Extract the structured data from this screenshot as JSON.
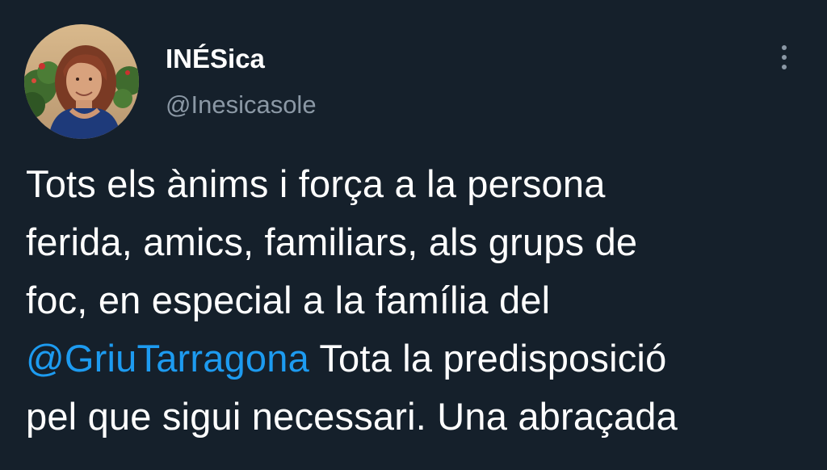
{
  "colors": {
    "background": "#15202b",
    "text_primary": "#ffffff",
    "text_secondary": "#8b98a5",
    "accent": "#1d9bf0"
  },
  "author": {
    "display_name": "INÉSica",
    "handle": "@Inesicasole",
    "avatar_icon": "profile-photo"
  },
  "actions": {
    "more_icon": "more-vertical-icon"
  },
  "tweet": {
    "line1": "Tots els ànims i força a la persona",
    "line2": "ferida, amics, familiars, als grups de",
    "line3": "foc, en especial a la família del",
    "mention": "@GriuTarragona",
    "line4_rest": " Tota la predisposició",
    "line5": "pel que sigui necessari. Una abraçada"
  }
}
